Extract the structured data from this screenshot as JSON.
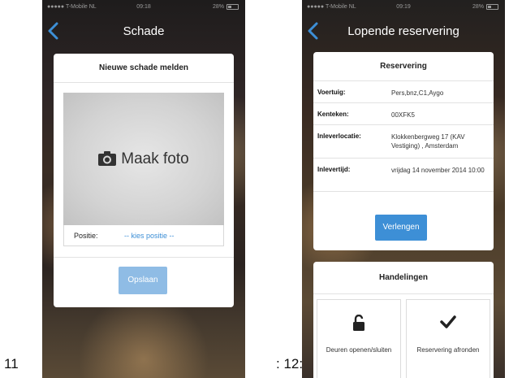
{
  "captions": {
    "first": "11",
    "second": ": 12:"
  },
  "screens": [
    {
      "status": {
        "carrier": "●●●●● T-Mobile NL",
        "time": "09:18",
        "battery": "28%"
      },
      "nav": {
        "title": "Schade",
        "back_icon": "chevron-left-icon"
      },
      "card": {
        "title": "Nieuwe schade melden",
        "photo_button": "Maak foto",
        "photo_icon": "camera-icon",
        "position_label": "Positie:",
        "position_placeholder": "-- kies positie --",
        "save_button": "Opslaan"
      }
    },
    {
      "status": {
        "carrier": "●●●●● T-Mobile NL",
        "time": "09:19",
        "battery": "28%"
      },
      "nav": {
        "title": "Lopende reservering",
        "back_icon": "chevron-left-icon"
      },
      "reservation": {
        "title": "Reservering",
        "rows": [
          {
            "key": "Voertuig:",
            "value": "Pers,bnz,C1,Aygo"
          },
          {
            "key": "Kenteken:",
            "value": "00XFK5"
          },
          {
            "key": "Inleverlocatie:",
            "value": "Klokkenbergweg 17 (KAV Vestiging) , Amsterdam"
          },
          {
            "key": "Inlevertijd:",
            "value": "vrijdag 14 november 2014 10:00"
          }
        ],
        "extend_button": "Verlengen"
      },
      "actions": {
        "title": "Handelingen",
        "items": [
          {
            "label": "Deuren openen/sluiten",
            "icon": "unlock-icon"
          },
          {
            "label": "Reservering afronden",
            "icon": "checkmark-icon"
          }
        ]
      },
      "colors": {
        "accent": "#3d8fd6",
        "accent_disabled": "#8fbce5"
      }
    }
  ]
}
